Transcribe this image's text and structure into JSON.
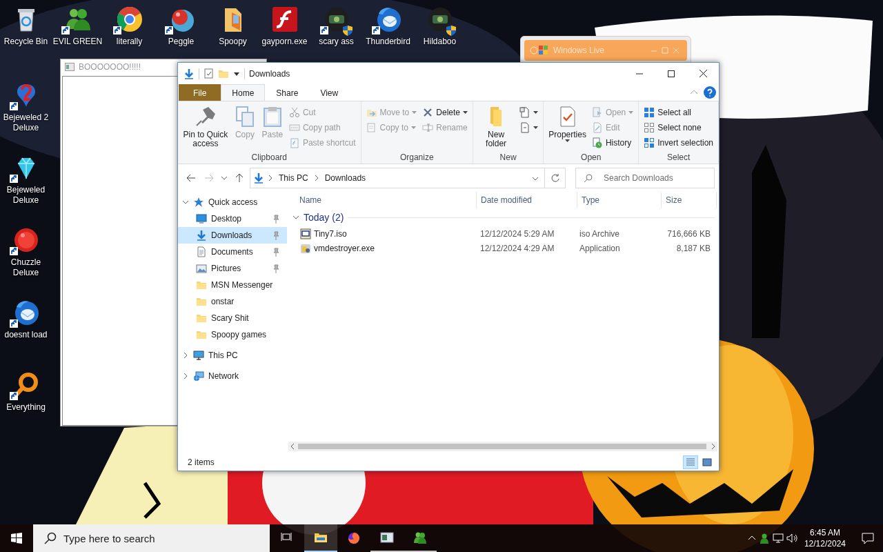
{
  "desktop": {
    "top_row": [
      {
        "label": "Recycle Bin",
        "kind": "recycle",
        "shortcut": false,
        "shield": false
      },
      {
        "label": "EVIL GREEN",
        "kind": "people",
        "shortcut": true,
        "shield": false
      },
      {
        "label": "literally",
        "kind": "browser",
        "shortcut": true,
        "shield": false
      },
      {
        "label": "Peggle",
        "kind": "ball",
        "shortcut": true,
        "shield": false
      },
      {
        "label": "Spoopy",
        "kind": "folder",
        "shortcut": false,
        "shield": false
      },
      {
        "label": "gayporn.exe",
        "kind": "flash",
        "shortcut": false,
        "shield": false
      },
      {
        "label": "scary ass",
        "kind": "app",
        "shortcut": true,
        "shield": true
      },
      {
        "label": "Thunderbird",
        "kind": "mail",
        "shortcut": true,
        "shield": false
      },
      {
        "label": "Hildaboo",
        "kind": "app",
        "shortcut": false,
        "shield": true
      }
    ],
    "left_column": [
      {
        "label": "Bejeweled 2 Deluxe",
        "kind": "gem",
        "shortcut": true,
        "shield": false
      },
      {
        "label": "Bejeweled Deluxe",
        "kind": "diamond",
        "shortcut": true,
        "shield": false
      },
      {
        "label": "Chuzzle Deluxe",
        "kind": "redball",
        "shortcut": true,
        "shield": false
      },
      {
        "label": "doesnt load",
        "kind": "mail",
        "shortcut": true,
        "shield": false
      },
      {
        "label": "Everything",
        "kind": "magnifier",
        "shortcut": true,
        "shield": false
      }
    ]
  },
  "background_windows": [
    {
      "title": "BOOOOOOO!!!!!",
      "kind": "plain"
    },
    {
      "title": "Windows Live",
      "kind": "live"
    }
  ],
  "explorer": {
    "title": "Downloads",
    "ribbon_tabs": [
      {
        "label": "File",
        "kind": "file",
        "selected": false
      },
      {
        "label": "Home",
        "kind": "tab",
        "selected": true
      },
      {
        "label": "Share",
        "kind": "tab",
        "selected": false
      },
      {
        "label": "View",
        "kind": "tab",
        "selected": false
      }
    ],
    "ribbon_groups": [
      {
        "label": "Clipboard",
        "columns": [
          [
            {
              "label": "Pin to Quick access",
              "kind": "pin",
              "disabled": false,
              "dropdown": false
            }
          ],
          [
            {
              "label": "Copy",
              "kind": "copy",
              "disabled": true,
              "dropdown": false
            }
          ],
          [
            {
              "label": "Paste",
              "kind": "paste",
              "disabled": true,
              "dropdown": false
            }
          ],
          [
            {
              "label": "Cut",
              "kind": "cut",
              "disabled": true,
              "dropdown": false
            },
            {
              "label": "Copy path",
              "kind": "copypath",
              "disabled": true,
              "dropdown": false
            },
            {
              "label": "Paste shortcut",
              "kind": "pasteshortcut",
              "disabled": true,
              "dropdown": false
            }
          ]
        ]
      },
      {
        "label": "Organize",
        "columns": [
          [
            {
              "label": "Move to",
              "kind": "moveto",
              "disabled": true,
              "dropdown": true
            },
            {
              "label": "Copy to",
              "kind": "copyto",
              "disabled": true,
              "dropdown": true
            }
          ],
          [
            {
              "label": "Delete",
              "kind": "delete",
              "disabled": false,
              "dropdown": true
            },
            {
              "label": "Rename",
              "kind": "rename",
              "disabled": true,
              "dropdown": false
            }
          ]
        ]
      },
      {
        "label": "New",
        "columns": [
          [
            {
              "label": "New folder",
              "kind": "newfolder",
              "disabled": false,
              "dropdown": false
            }
          ],
          [
            {
              "kind": "newitem",
              "disabled": false,
              "dropdown": true
            },
            {
              "kind": "easyaccess",
              "disabled": false,
              "dropdown": true
            }
          ]
        ]
      },
      {
        "label": "Open",
        "columns": [
          [
            {
              "label": "Properties",
              "kind": "properties",
              "disabled": false,
              "dropdown": true
            }
          ],
          [
            {
              "label": "Open",
              "kind": "open",
              "disabled": true,
              "dropdown": true
            },
            {
              "label": "Edit",
              "kind": "edit",
              "disabled": true,
              "dropdown": false
            },
            {
              "label": "History",
              "kind": "history",
              "disabled": false,
              "dropdown": false
            }
          ]
        ]
      },
      {
        "label": "Select",
        "columns": [
          [
            {
              "label": "Select all",
              "kind": "selectall",
              "disabled": false,
              "dropdown": false
            },
            {
              "label": "Select none",
              "kind": "selectnone",
              "disabled": false,
              "dropdown": false
            },
            {
              "label": "Invert selection",
              "kind": "invert",
              "disabled": false,
              "dropdown": false
            }
          ]
        ]
      }
    ],
    "address": [
      "This PC",
      "Downloads"
    ],
    "search": {
      "placeholder": "Search Downloads"
    },
    "nav": [
      {
        "label": "Quick access",
        "kind": "star",
        "expanded": true,
        "selected": false,
        "children": [
          {
            "label": "Desktop",
            "kind": "desktop",
            "pinned": true,
            "selected": false
          },
          {
            "label": "Downloads",
            "kind": "download",
            "pinned": true,
            "selected": true
          },
          {
            "label": "Documents",
            "kind": "document",
            "pinned": true,
            "selected": false
          },
          {
            "label": "Pictures",
            "kind": "pictures",
            "pinned": true,
            "selected": false
          },
          {
            "label": "MSN Messenger",
            "kind": "folder",
            "pinned": false,
            "selected": false
          },
          {
            "label": "onstar",
            "kind": "folder",
            "pinned": false,
            "selected": false
          },
          {
            "label": "Scary Shit",
            "kind": "folder",
            "pinned": false,
            "selected": false
          },
          {
            "label": "Spoopy games",
            "kind": "folder",
            "pinned": false,
            "selected": false
          }
        ]
      },
      {
        "label": "This PC",
        "kind": "pc",
        "expanded": false,
        "selected": false
      },
      {
        "label": "Network",
        "kind": "network",
        "expanded": false,
        "selected": false
      }
    ],
    "columns": [
      {
        "label": "Name",
        "sorted": false
      },
      {
        "label": "Date modified",
        "sorted": true
      },
      {
        "label": "Type",
        "sorted": false
      },
      {
        "label": "Size",
        "sorted": false
      }
    ],
    "groups": [
      {
        "label": "Today (2)",
        "expanded": true,
        "rows": [
          {
            "name": "Tiny7.iso",
            "kind": "iso",
            "date": "12/12/2024 5:29 AM",
            "type": "iso Archive",
            "size": "716,666 KB",
            "selected": false
          },
          {
            "name": "vmdestroyer.exe",
            "kind": "exe",
            "date": "12/12/2024 4:29 AM",
            "type": "Application",
            "size": "8,187 KB",
            "selected": false
          }
        ]
      }
    ],
    "status": "2 items",
    "views": [
      {
        "kind": "details",
        "selected": true
      },
      {
        "kind": "largeicons",
        "selected": false
      }
    ]
  },
  "taskbar": {
    "search": {
      "placeholder": "Type here to search"
    },
    "apps": [
      {
        "kind": "taskview",
        "running": false,
        "selected": false
      },
      {
        "kind": "explorer",
        "running": true,
        "selected": true
      },
      {
        "kind": "firefox",
        "running": false,
        "selected": false
      },
      {
        "kind": "window",
        "running": true,
        "selected": false
      },
      {
        "kind": "msn",
        "running": true,
        "selected": false
      }
    ],
    "time": "6:45 AM",
    "date": "12/12/2024"
  }
}
